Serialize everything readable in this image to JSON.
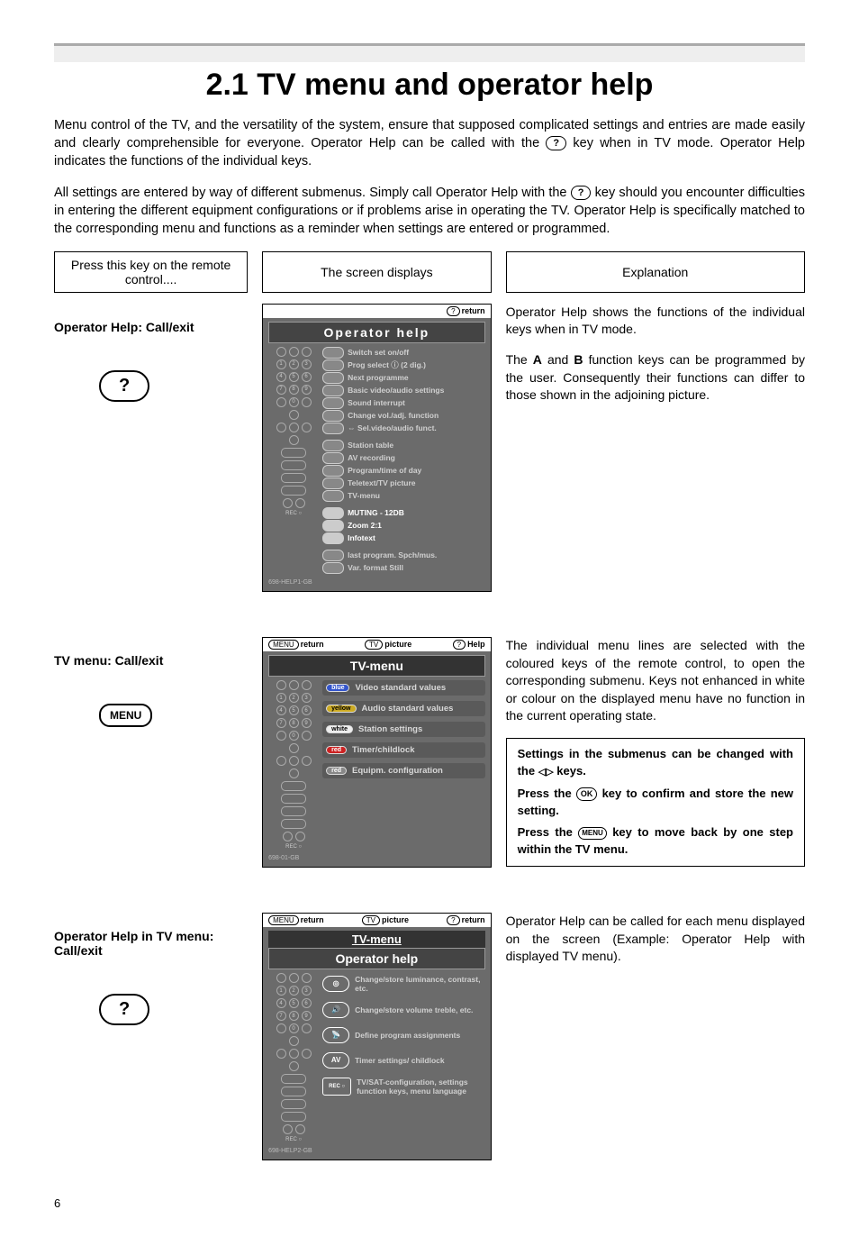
{
  "title": "2.1 TV menu and operator help",
  "intro1_a": "Menu control of the TV, and the versatility of the system, ensure that supposed complicated settings and entries are made easily and clearly comprehensible for everyone. Operator Help can be called with the ",
  "intro1_key": "?",
  "intro1_b": " key when in TV mode. Operator Help indicates the functions of the individual keys.",
  "intro2_a": "All settings are entered by way of different submenus. Simply call Operator Help with the ",
  "intro2_key": "?",
  "intro2_b": " key should you encounter difficulties in entering the different equipment configurations or if problems arise in operating the TV. Operator Help is specifically matched to the corresponding menu and functions as a reminder when settings are entered or programmed.",
  "header_left": "Press this key on the remote control....",
  "header_mid": "The screen displays",
  "header_right": "Explanation",
  "row1": {
    "left_title": "Operator Help: Call/exit",
    "key": "?",
    "top_return": "return",
    "screen_title": "Operator help",
    "lines": [
      "Switch set on/off",
      "Prog select  ⓘ (2 dig.)",
      "Next programme",
      "Basic video/audio settings",
      "Sound interrupt",
      "Change vol./adj. function",
      "⇔ Sel.video/audio funct.",
      "Station table",
      "AV recording",
      "Program/time of day",
      "Teletext/TV picture",
      "TV-menu",
      "MUTING - 12DB",
      "Zoom 2:1",
      "Infotext",
      "last program.   Spch/mus.",
      "Var. format     Still"
    ],
    "footer": "698-HELP1-GB",
    "explain1": "Operator Help shows the functions of the individual keys when in TV mode.",
    "explain2_a": "The ",
    "explain2_b": " and ",
    "explain2_c": " function keys can be programmed by the user. Consequently their functions can differ to those shown in the adjoining picture.",
    "A": "A",
    "B": "B"
  },
  "row2": {
    "left_title": "TV menu: Call/exit",
    "key": "MENU",
    "top_left": "return",
    "top_mid_key": "TV",
    "top_mid": "picture",
    "top_right_key": "?",
    "top_right": "Help",
    "screen_title": "TV-menu",
    "items": [
      {
        "chip": "blue",
        "chip_label": "blue",
        "label": "Video standard values"
      },
      {
        "chip": "yellow",
        "chip_label": "yellow",
        "label": "Audio standard values"
      },
      {
        "chip": "white",
        "chip_label": "white",
        "label": "Station settings"
      },
      {
        "chip": "red",
        "chip_label": "red",
        "label": "Timer/childlock"
      },
      {
        "chip": "grey",
        "chip_label": "red",
        "label": "Equipm. configuration"
      }
    ],
    "footer": "698-01-GB",
    "explain": "The individual menu lines are selected with the coloured keys of the remote control, to open the corresponding submenu. Keys not enhanced in white or colour on the displayed menu have no function in the current operating state.",
    "note1": "Settings in the submenus can be changed with the  keys.",
    "note1_a": "Settings in the submenus can be changed with the ",
    "note1_b": " keys.",
    "note2_a": "Press the ",
    "note2_ok": "OK",
    "note2_b": " key to confirm and store the new setting.",
    "note3_a": "Press the ",
    "note3_menu": "MENU",
    "note3_b": " key to move back by one step within the TV menu."
  },
  "row3": {
    "left_title": "Operator Help in TV menu: Call/exit",
    "key": "?",
    "top_left_key": "MENU",
    "top_left": "return",
    "top_mid_key": "TV",
    "top_mid": "picture",
    "top_right_key": "?",
    "top_right": "return",
    "title1": "TV-menu",
    "title2": "Operator help",
    "items": [
      {
        "btn": "◎",
        "text": "Change/store luminance, contrast, etc."
      },
      {
        "btn": "🔊",
        "text": "Change/store volume treble, etc."
      },
      {
        "btn": "📡",
        "text": "Define program assignments"
      },
      {
        "btn": "AV",
        "text": "Timer settings/ childlock"
      },
      {
        "btn": "REC ○",
        "rect": true,
        "text": "TV/SAT-configuration, settings function keys, menu language"
      }
    ],
    "footer": "698-HELP2-GB",
    "explain": "Operator Help can be called for each menu displayed on the screen (Example: Operator Help with displayed TV menu)."
  },
  "pagenum": "6"
}
